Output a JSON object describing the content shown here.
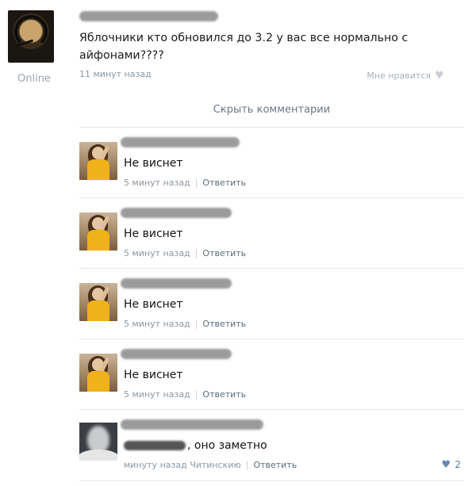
{
  "post": {
    "status": "Online",
    "text": "Яблочники кто обновился до 3.2 у вас все нормально с айфонами????",
    "time": "11 минут назад",
    "like_label": "Мне нравится",
    "like_icon": "heart-icon"
  },
  "hide_comments_label": "Скрыть комментарии",
  "comments": [
    {
      "text": "Не виснет",
      "time": "5 минут назад",
      "reply": "Ответить"
    },
    {
      "text": "Не виснет",
      "time": "5 минут назад",
      "reply": "Ответить"
    },
    {
      "text": "Не виснет",
      "time": "5 минут назад",
      "reply": "Ответить"
    },
    {
      "text": "Не виснет",
      "time": "5 минут назад",
      "reply": "Ответить"
    }
  ],
  "last_comment": {
    "text": ", оно заметно",
    "time": "минуту назад Читинскию",
    "reply": "Ответить",
    "likes": "2"
  },
  "colors": {
    "link": "#5b6b7c",
    "meta": "#8c97a1",
    "separator": "#e4e7ea",
    "like_active": "#5f8bb3"
  }
}
